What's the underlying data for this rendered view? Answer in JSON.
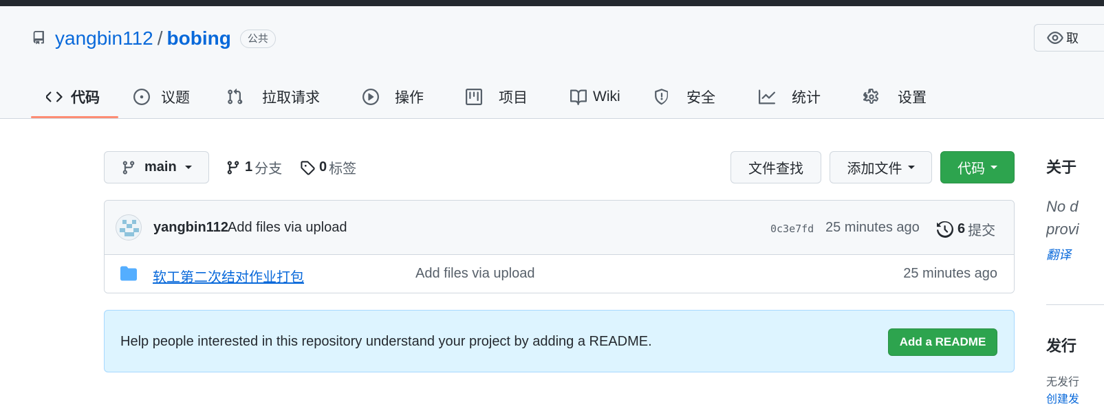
{
  "repo": {
    "owner": "yangbin112",
    "separator": "/",
    "name": "bobing",
    "visibility": "公共",
    "watch_label": "取"
  },
  "tabs": [
    {
      "label": "代码",
      "icon": "code-icon",
      "active": true
    },
    {
      "label": "议题",
      "icon": "issue-opened-icon"
    },
    {
      "label": "拉取请求",
      "icon": "git-pull-request-icon"
    },
    {
      "label": "操作",
      "icon": "play-icon"
    },
    {
      "label": "项目",
      "icon": "project-icon"
    },
    {
      "label": "Wiki",
      "icon": "book-icon"
    },
    {
      "label": "安全",
      "icon": "shield-icon"
    },
    {
      "label": "统计",
      "icon": "graph-icon"
    },
    {
      "label": "设置",
      "icon": "gear-icon"
    }
  ],
  "toolbar": {
    "branch": "main",
    "branch_count": "1",
    "branch_label": "分支",
    "tag_count": "0",
    "tag_label": "标签",
    "find_file": "文件查找",
    "add_file": "添加文件",
    "code": "代码"
  },
  "latest_commit": {
    "author": "yangbin112",
    "message": "Add files via upload",
    "sha": "0c3e7fd",
    "time": "25 minutes ago",
    "count": "6",
    "count_label": "提交"
  },
  "files": [
    {
      "name": "软工第二次结对作业打包",
      "type": "folder",
      "message": "Add files via upload",
      "time": "25 minutes ago"
    }
  ],
  "readme_prompt": {
    "text": "Help people interested in this repository understand your project by adding a README.",
    "button": "Add a README"
  },
  "sidebar": {
    "about_title": "关于",
    "description_line1": "No d",
    "description_line2": "provi",
    "translate": "翻译",
    "releases_title": "发行",
    "no_releases": "无发行",
    "create_release": "创建发"
  },
  "colors": {
    "accent": "#0969da",
    "primary_button": "#2da44e",
    "tab_underline": "#fd8c73",
    "readme_bg": "#ddf4ff"
  }
}
